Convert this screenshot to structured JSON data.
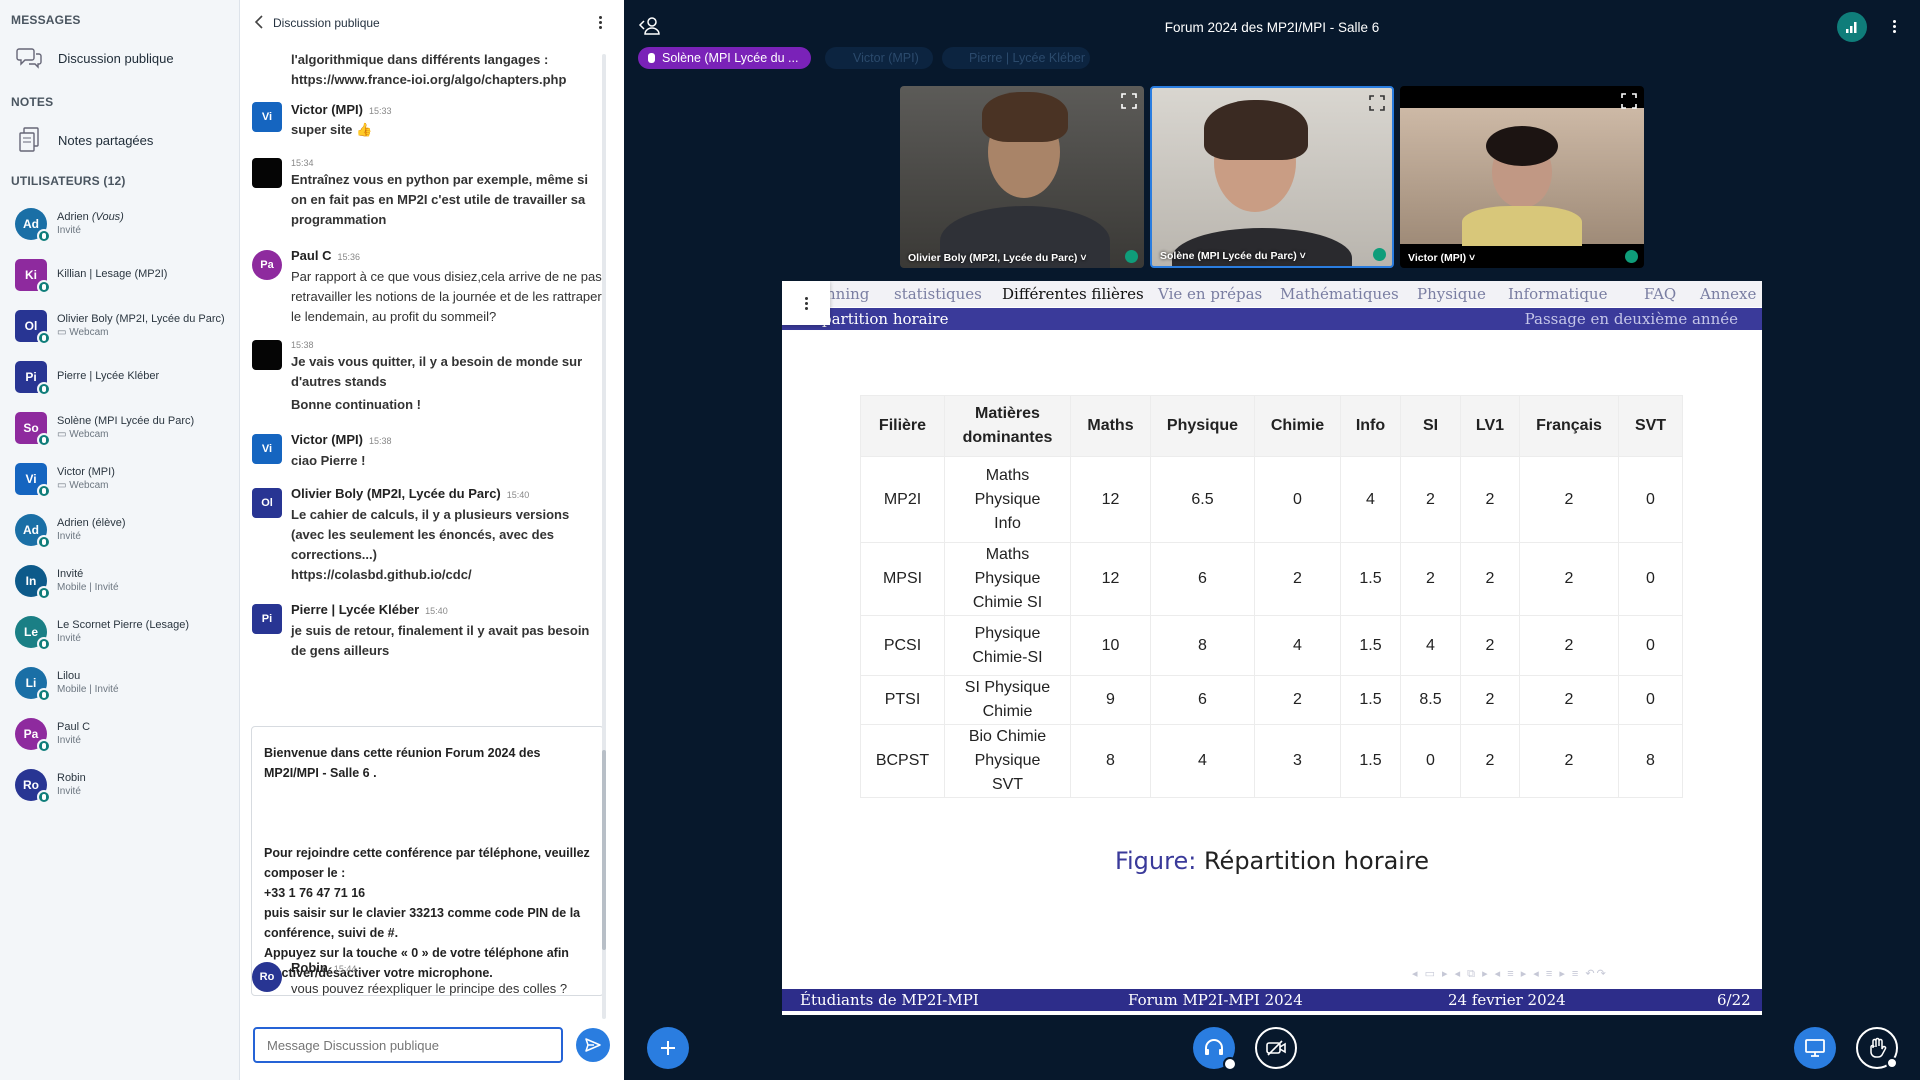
{
  "sidebar": {
    "messages_title": "MESSAGES",
    "public_chat": "Discussion publique",
    "notes_title": "NOTES",
    "shared_notes": "Notes partagées",
    "users_title": "UTILISATEURS (12)",
    "users": [
      {
        "initials": "Ad",
        "name": "Adrien ",
        "you": "(Vous)",
        "status": "Invité",
        "color": "#1a6fa6"
      },
      {
        "initials": "Ki",
        "name": "Killian | Lesage (MP2I)",
        "you": "",
        "status": "",
        "color": "#8e2a9e"
      },
      {
        "initials": "Ol",
        "name": "Olivier Boly (MP2I, Lycée du Parc)",
        "you": "",
        "status": "▭ Webcam",
        "color": "#283593"
      },
      {
        "initials": "Pi",
        "name": "Pierre | Lycée Kléber",
        "you": "",
        "status": "",
        "color": "#283593"
      },
      {
        "initials": "So",
        "name": "Solène (MPI Lycée du Parc)",
        "you": "",
        "status": "▭ Webcam",
        "color": "#8e2a9e"
      },
      {
        "initials": "Vi",
        "name": "Victor (MPI)",
        "you": "",
        "status": "▭ Webcam",
        "color": "#1565c0"
      },
      {
        "initials": "Ad",
        "name": "Adrien (élève)",
        "you": "",
        "status": "Invité",
        "color": "#1a6fa6"
      },
      {
        "initials": "In",
        "name": "Invité",
        "you": "",
        "status": "Mobile | Invité",
        "color": "#0d5a8a"
      },
      {
        "initials": "Le",
        "name": "Le Scornet Pierre (Lesage)",
        "you": "",
        "status": "Invité",
        "color": "#1a7f85"
      },
      {
        "initials": "Li",
        "name": "Lilou",
        "you": "",
        "status": "Mobile | Invité",
        "color": "#1a6fa6"
      },
      {
        "initials": "Pa",
        "name": "Paul C",
        "you": "",
        "status": "Invité",
        "color": "#8e2a9e"
      },
      {
        "initials": "Ro",
        "name": "Robin",
        "you": "",
        "status": "Invité",
        "color": "#283593"
      }
    ]
  },
  "chat": {
    "header_title": "Discussion publique",
    "messages": [
      {
        "text": "l'algorithmique dans différents langages :",
        "link": "https://www.france-ioi.org/algo/chapters.php"
      },
      {
        "initials": "Vi",
        "author": "Victor (MPI)",
        "time": "15:33",
        "text": "super site 👍"
      },
      {
        "time": "15:34",
        "text": "Entraînez vous en python par exemple, même si on en fait pas en MP2I c'est utile de travailler sa programmation"
      },
      {
        "initials": "Pa",
        "author": "Paul C",
        "time": "15:36",
        "text": "Par rapport à ce que vous disiez,cela arrive de ne pas retravailler les notions de la journée et de les rattraper le lendemain, au profit du sommeil?"
      },
      {
        "time": "15:38",
        "text": "Je vais vous quitter, il y a besoin de monde sur d'autres stands",
        "text2": "Bonne continuation !"
      },
      {
        "initials": "Vi",
        "author": "Victor (MPI)",
        "time": "15:38",
        "text": "ciao Pierre !"
      },
      {
        "initials": "Ol",
        "author": "Olivier Boly (MP2I, Lycée du Parc)",
        "time": "15:40",
        "text": "Le cahier de calculs, il y a plusieurs versions (avec les seulement les énoncés, avec des corrections...)",
        "link": "https://colasbd.github.io/cdc/"
      },
      {
        "initials": "Pi",
        "author": "Pierre | Lycée Kléber",
        "time": "15:40",
        "text": "je suis de retour, finalement il y avait pas besoin de gens ailleurs"
      },
      {
        "initials": "Ro",
        "author": "Robin",
        "time": "15:44",
        "text": "vous pouvez réexpliquer le principe des colles ?"
      }
    ],
    "welcome": {
      "line1": "Bienvenue dans cette réunion Forum 2024 des MP2I/MPI - Salle 6 .",
      "line2": "Pour rejoindre cette conférence par téléphone, veuillez composer le :",
      "phone": "+33 1 76 47 71 16",
      "line3": "puis saisir sur le clavier 33213 comme code PIN de la conférence, suivi de #.",
      "line4": "Appuyez sur la touche « 0 » de votre téléphone afin d'activer/désactiver votre microphone."
    },
    "input_placeholder": "Message Discussion publique"
  },
  "stage": {
    "title": "Forum 2024 des MP2I/MPI - Salle 6",
    "talking": [
      "Solène (MPI Lycée du ...",
      "Victor (MPI)",
      "Pierre | Lycée Kléber"
    ],
    "videos": [
      {
        "label": "Olivier Boly (MP2I, Lycée du Parc) ˅"
      },
      {
        "label": "Solène (MPI Lycée du Parc) ˅"
      },
      {
        "label": "Victor (MPI) ˅"
      }
    ]
  },
  "slide": {
    "nav": [
      "nning",
      "statistiques",
      "Différentes filières",
      "Vie en prépas",
      "Mathématiques",
      "Physique",
      "Informatique",
      "FAQ",
      "Annexe"
    ],
    "sub_left": "partition horaire",
    "sub_right": "Passage en deuxième année",
    "table": {
      "headers": [
        "Filière",
        "Matières dominantes",
        "Maths",
        "Physique",
        "Chimie",
        "Info",
        "SI",
        "LV1",
        "Français",
        "SVT"
      ],
      "rows": [
        [
          "MP2I",
          "Maths\nPhysique\nInfo",
          "12",
          "6.5",
          "0",
          "4",
          "2",
          "2",
          "2",
          "0"
        ],
        [
          "MPSI",
          "Maths\nPhysique\nChimie SI",
          "12",
          "6",
          "2",
          "1.5",
          "2",
          "2",
          "2",
          "0"
        ],
        [
          "PCSI",
          "Physique\nChimie-SI",
          "10",
          "8",
          "4",
          "1.5",
          "4",
          "2",
          "2",
          "0"
        ],
        [
          "PTSI",
          "SI Physique\nChimie",
          "9",
          "6",
          "2",
          "1.5",
          "8.5",
          "2",
          "2",
          "0"
        ],
        [
          "BCPST",
          "Bio Chimie\nPhysique\nSVT",
          "8",
          "4",
          "3",
          "1.5",
          "0",
          "2",
          "2",
          "8"
        ]
      ]
    },
    "caption_label": "Figure:",
    "caption_text": "Répartition horaire",
    "nav_controls": "◂ ▭ ▸ ◂ ⧉ ▸ ◂ ≡ ▸ ◂ ≡ ▸ ≡ ↶↷",
    "footer": {
      "left": "Étudiants de MP2I-MPI",
      "center": "Forum MP2I-MPI 2024",
      "date": "24 fevrier 2024",
      "page": "6/22"
    }
  },
  "colors": {
    "stage_bg": "#07182c",
    "primary": "#2a7de0",
    "beamer": "#3a3a9a",
    "connection": "#0f7d7a"
  }
}
